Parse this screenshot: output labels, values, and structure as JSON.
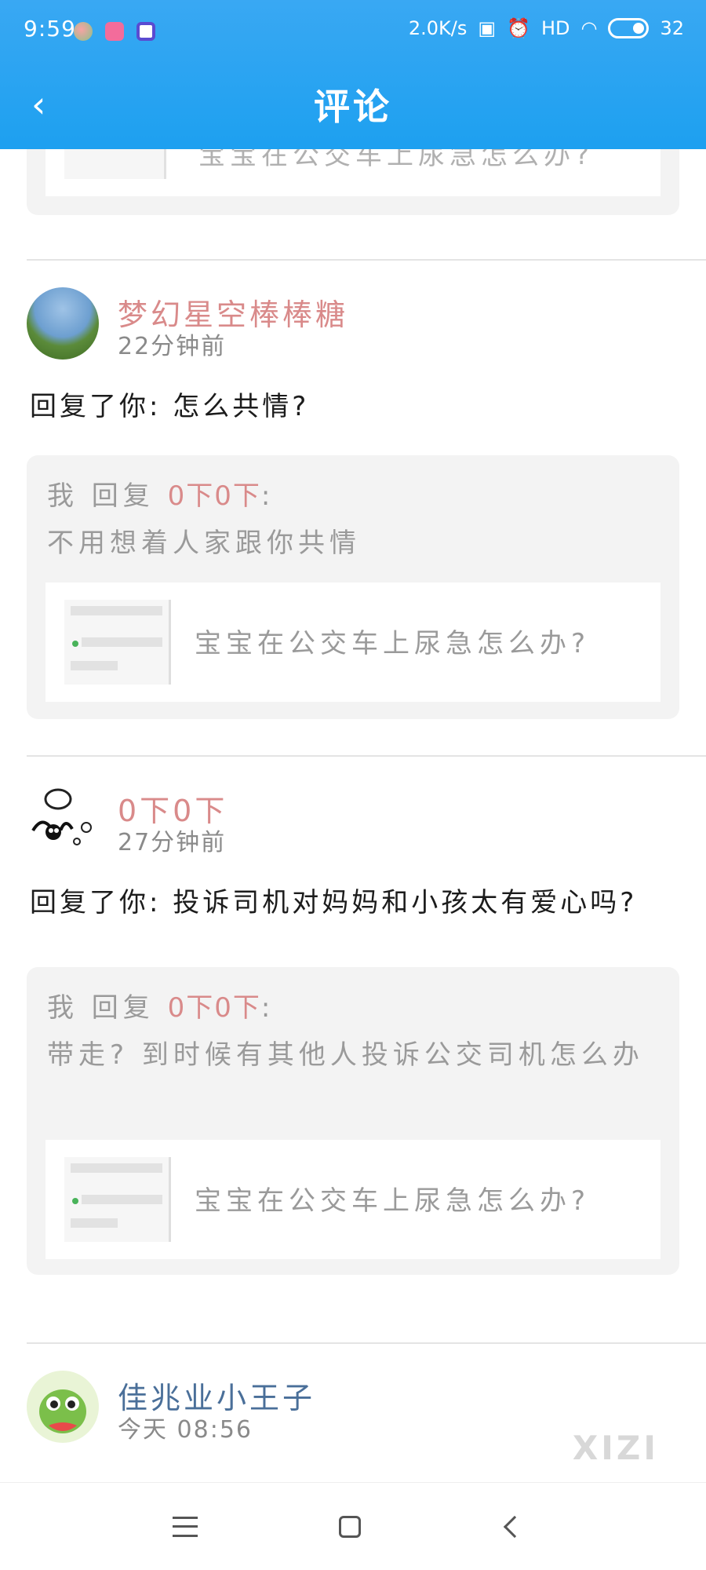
{
  "status_bar": {
    "time": "9:59",
    "speed": "2.0K/s",
    "signal": "HD",
    "battery": "32"
  },
  "header": {
    "title": "评论",
    "back_icon": "chevron-left-icon"
  },
  "partial_card": {
    "link_text": "宝宝在公交车上尿急怎么办?"
  },
  "comments": [
    {
      "name": "梦幻星空棒棒糖",
      "time": "22分钟前",
      "message": "回复了你: 怎么共情?",
      "quote": {
        "prefix": "我 回复 ",
        "who": "0下0下",
        "suffix": ":",
        "text": "不用想着人家跟你共情",
        "link_text": "宝宝在公交车上尿急怎么办?"
      }
    },
    {
      "name": "0下0下",
      "time": "27分钟前",
      "message": "回复了你: 投诉司机对妈妈和小孩太有爱心吗?",
      "quote": {
        "prefix": "我 回复 ",
        "who": "0下0下",
        "suffix": ":",
        "text": "带走? 到时候有其他人投诉公交司机怎么办",
        "link_text": "宝宝在公交车上尿急怎么办?"
      }
    },
    {
      "name": "佳兆业小王子",
      "time": "今天 08:56"
    }
  ],
  "watermark": "XIZI",
  "colors": {
    "header_bg": "#1da0f0",
    "name_pink": "#d98a8a",
    "name_blue": "#4a6f99",
    "quote_bg": "#f3f3f3"
  },
  "nav": {
    "menu_icon": "menu-icon",
    "home_icon": "home-icon",
    "back_icon": "back-icon"
  }
}
